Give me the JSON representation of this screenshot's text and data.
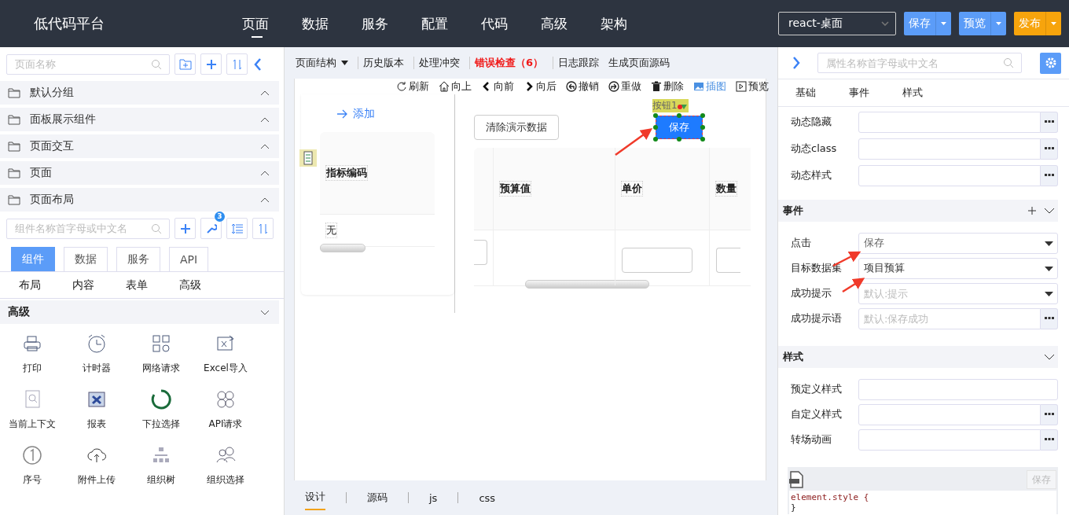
{
  "header": {
    "logo": "低代码平台",
    "nav": [
      {
        "label": "页面",
        "selected": true
      },
      {
        "label": "数据",
        "selected": false
      },
      {
        "label": "服务",
        "selected": false
      },
      {
        "label": "配置",
        "selected": false
      },
      {
        "label": "代码",
        "selected": false
      },
      {
        "label": "高级",
        "selected": false
      },
      {
        "label": "架构",
        "selected": false
      }
    ],
    "env_select": {
      "value": "react-桌面"
    },
    "buttons": [
      {
        "label": "保存",
        "kind": "primary"
      },
      {
        "label": "预览",
        "kind": "primary"
      },
      {
        "label": "发布",
        "kind": "warning"
      }
    ]
  },
  "left": {
    "page_search": {
      "placeholder": "页面名称"
    },
    "groups": [
      {
        "label": "默认分组"
      },
      {
        "label": "面板展示组件"
      },
      {
        "label": "页面交互"
      },
      {
        "label": "页面"
      },
      {
        "label": "页面布局"
      }
    ],
    "component_search": {
      "placeholder": "组件名称首字母或中文名"
    },
    "tool_badge": "3",
    "tabs": [
      {
        "label": "组件",
        "selected": true
      },
      {
        "label": "数据",
        "selected": false
      },
      {
        "label": "服务",
        "selected": false
      },
      {
        "label": "API",
        "selected": false
      }
    ],
    "categories": [
      "布局",
      "内容",
      "表单",
      "高级"
    ],
    "section": "高级",
    "components": [
      "打印",
      "计时器",
      "网络请求",
      "Excel导入",
      "当前上下文",
      "报表",
      "下拉选择",
      "API请求",
      "序号",
      "附件上传",
      "组织树",
      "组织选择"
    ]
  },
  "center": {
    "menu": [
      {
        "label": "页面结构",
        "kind": "dropdown"
      },
      {
        "label": "历史版本",
        "kind": "plain"
      },
      {
        "label": "处理冲突",
        "kind": "plain"
      },
      {
        "label": "错误检查（6）",
        "kind": "error"
      },
      {
        "label": "日志跟踪",
        "kind": "plain"
      },
      {
        "label": "生成页面源码",
        "kind": "plain"
      }
    ],
    "actions": [
      {
        "label": "刷新",
        "active": false
      },
      {
        "label": "向上",
        "active": false
      },
      {
        "label": "向前",
        "active": false
      },
      {
        "label": "向后",
        "active": false
      },
      {
        "label": "撤销",
        "active": false
      },
      {
        "label": "重做",
        "active": false
      },
      {
        "label": "删除",
        "active": false
      },
      {
        "label": "插图",
        "active": true
      },
      {
        "label": "预览",
        "active": false
      }
    ],
    "add_link": "添加",
    "left_table": {
      "columns": [
        "指标编码"
      ],
      "rows": [
        [
          "无"
        ]
      ]
    },
    "clear_button": "清除演示数据",
    "selected_component": {
      "tag": "按钮1",
      "label": "保存"
    },
    "right_table": {
      "columns": [
        {
          "kind": "blank"
        },
        {
          "kind": "text",
          "label": "预算值"
        },
        {
          "kind": "text",
          "label": "单价"
        },
        {
          "kind": "text",
          "label": "数量"
        }
      ],
      "rows": [
        {
          "cells": [
            {
              "kind": "input"
            },
            {
              "kind": "empty"
            },
            {
              "kind": "input"
            },
            {
              "kind": "input"
            }
          ]
        }
      ]
    },
    "bottom_tabs": [
      {
        "label": "设计",
        "selected": true
      },
      {
        "label": "源码",
        "selected": false
      },
      {
        "label": "js",
        "selected": false
      },
      {
        "label": "css",
        "selected": false
      }
    ]
  },
  "right": {
    "search": {
      "placeholder": "属性名称首字母或中文名"
    },
    "tabs": [
      {
        "label": "基础"
      },
      {
        "label": "事件"
      },
      {
        "label": "样式"
      }
    ],
    "sections": [
      {
        "rows": [
          {
            "label": "动态隐藏",
            "kind": "dots"
          },
          {
            "label": "动态class",
            "kind": "dots"
          },
          {
            "label": "动态样式",
            "kind": "dots"
          }
        ]
      },
      {
        "title": "事件",
        "addable": true,
        "rows": [
          {
            "label": "点击",
            "kind": "select",
            "value": "保存"
          },
          {
            "label": "目标数据集",
            "kind": "select",
            "value": "项目预算"
          },
          {
            "label": "成功提示",
            "kind": "select",
            "placeholder": "默认:提示"
          },
          {
            "label": "成功提示语",
            "kind": "dots",
            "placeholder": "默认:保存成功"
          }
        ]
      },
      {
        "title": "样式",
        "addable": false,
        "rows": [
          {
            "label": "预定义样式",
            "kind": "text"
          },
          {
            "label": "自定义样式",
            "kind": "dots"
          },
          {
            "label": "转场动画",
            "kind": "dots"
          }
        ]
      }
    ],
    "editor": {
      "save": "保存",
      "code": [
        "element.style {",
        "}"
      ]
    }
  }
}
